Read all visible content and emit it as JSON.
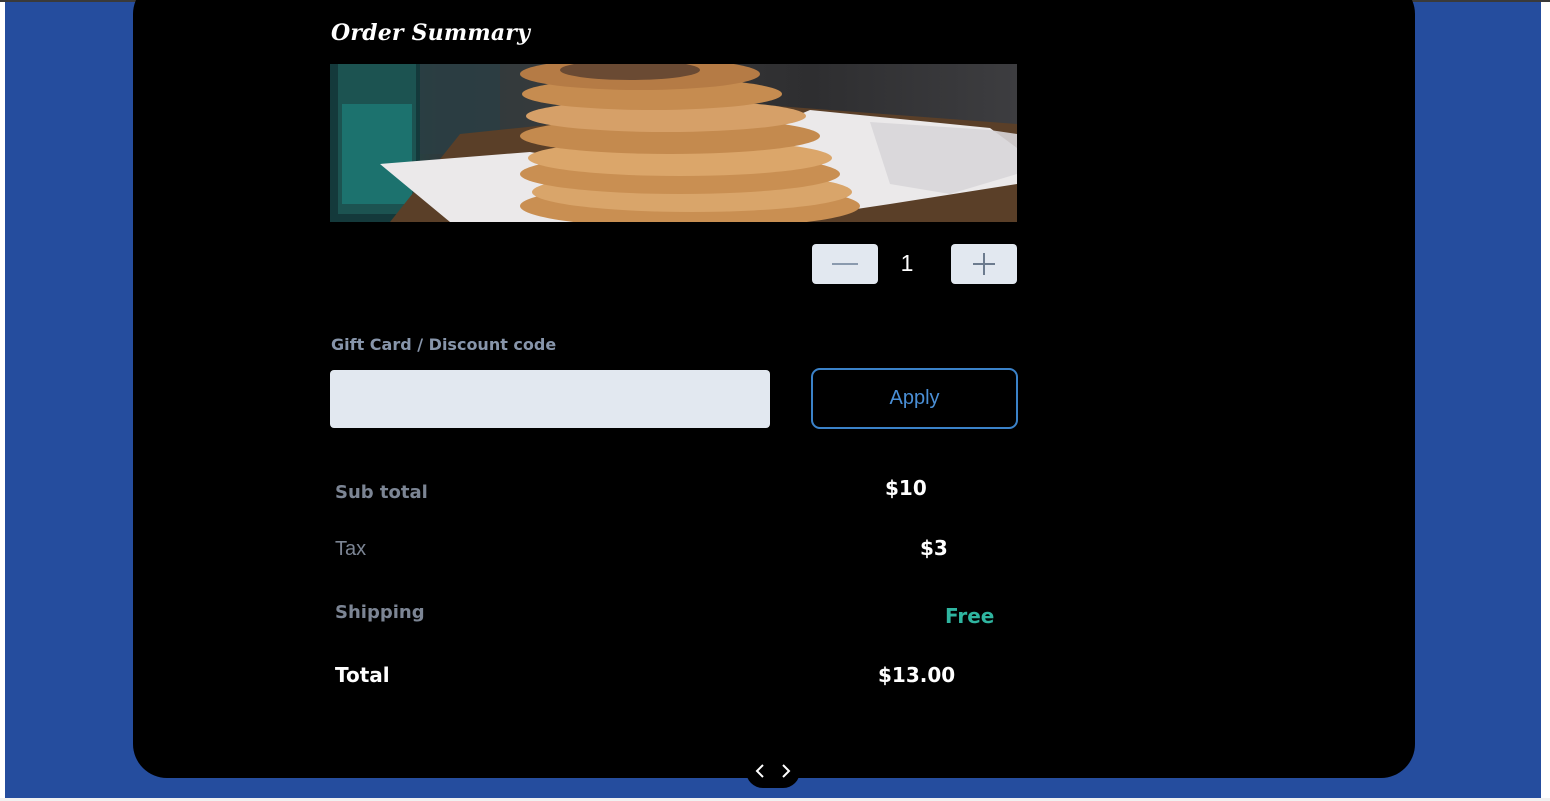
{
  "order": {
    "title": "Order Summary",
    "image_alt": "stack of stuffed flatbreads",
    "quantity": "1",
    "minus_icon": "minus-icon",
    "plus_icon": "plus-icon"
  },
  "discount": {
    "label": "Gift Card / Discount code",
    "value": "",
    "placeholder": "",
    "apply_label": "Apply"
  },
  "summary": {
    "subtotal_label": "Sub total",
    "subtotal_value": "$10",
    "tax_label": "Tax",
    "tax_value": "$3",
    "shipping_label": "Shipping",
    "shipping_value": "Free",
    "total_label": "Total",
    "total_value": "$13.00"
  },
  "colors": {
    "page_background": "#254d9e",
    "card_background": "#000000",
    "accent_blue": "#4a8fd6",
    "free_green": "#2fb5a0",
    "muted_label": "#7c8594",
    "input_background": "#e2e8f0"
  },
  "pager": {
    "prev_icon": "chevron-left-icon",
    "next_icon": "chevron-right-icon"
  }
}
